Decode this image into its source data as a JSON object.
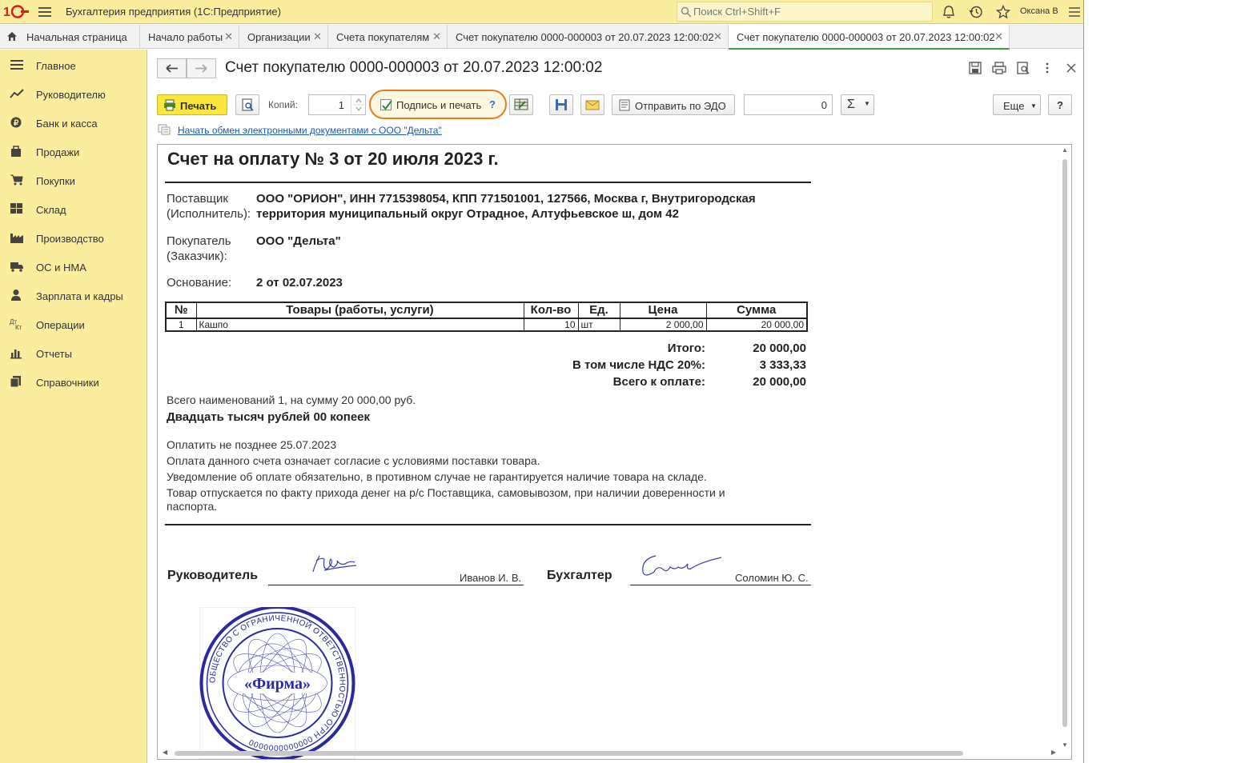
{
  "app": {
    "title": "Бухгалтерия предприятия  (1С:Предприятие)",
    "search_placeholder": "Поиск Ctrl+Shift+F",
    "user": "Оксана В"
  },
  "tabs": [
    {
      "label": "Начальная страница"
    },
    {
      "label": "Начало работы"
    },
    {
      "label": "Организации"
    },
    {
      "label": "Счета покупателям"
    },
    {
      "label": "Счет покупателю 0000-000003 от 20.07.2023 12:00:02"
    },
    {
      "label": "Счет покупателю 0000-000003 от 20.07.2023 12:00:02"
    }
  ],
  "sidebar": {
    "items": [
      {
        "label": "Главное",
        "icon": "menu-icon"
      },
      {
        "label": "Руководителю",
        "icon": "trend-icon"
      },
      {
        "label": "Банк и касса",
        "icon": "coin-icon"
      },
      {
        "label": "Продажи",
        "icon": "bag-icon"
      },
      {
        "label": "Покупки",
        "icon": "cart-icon"
      },
      {
        "label": "Склад",
        "icon": "warehouse-icon"
      },
      {
        "label": "Производство",
        "icon": "factory-icon"
      },
      {
        "label": "ОС и НМА",
        "icon": "truck-icon"
      },
      {
        "label": "Зарплата и кадры",
        "icon": "person-icon"
      },
      {
        "label": "Операции",
        "icon": "dt-kt-icon"
      },
      {
        "label": "Отчеты",
        "icon": "bar-chart-icon"
      },
      {
        "label": "Справочники",
        "icon": "books-icon"
      }
    ]
  },
  "form": {
    "title": "Счет покупателю 0000-000003 от 20.07.2023 12:00:02",
    "print_label": "Печать",
    "copies_label": "Копий:",
    "copies_value": "1",
    "sign_label": "Подпись и печать",
    "sign_help": "?",
    "sign_checked": true,
    "edo_label": "Отправить по ЭДО",
    "sum_value": "0",
    "sum_symbol": "Σ",
    "more_label": "Еще",
    "help_label": "?",
    "edo_link": "Начать обмен электронными документами с ООО \"Дельта\""
  },
  "invoice": {
    "heading": "Счет на оплату № 3 от 20 июля 2023 г.",
    "supplier_label_1": "Поставщик",
    "supplier_label_2": "(Исполнитель):",
    "supplier_line_1": "ООО \"ОРИОН\", ИНН 7715398054, КПП 771501001, 127566, Москва г, Внутригородская",
    "supplier_line_2": "территория муниципальный округ Отрадное, Алтуфьевское ш, дом 42",
    "buyer_label_1": "Покупатель",
    "buyer_label_2": "(Заказчик):",
    "buyer_value": "ООО \"Дельта\"",
    "basis_label": "Основание:",
    "basis_value": "2 от 02.07.2023",
    "table_headers": [
      "№",
      "Товары (работы, услуги)",
      "Кол-во",
      "Ед.",
      "Цена",
      "Сумма"
    ],
    "rows": [
      {
        "n": "1",
        "name": "Кашпо",
        "qty": "10",
        "unit": "шт",
        "price": "2 000,00",
        "sum": "20 000,00"
      }
    ],
    "total_label": "Итого:",
    "total_value": "20 000,00",
    "vat_label": "В том числе НДС 20%:",
    "vat_value": "3 333,33",
    "due_label": "Всего к оплате:",
    "due_value": "20 000,00",
    "count_line": "Всего наименований 1, на сумму 20 000,00 руб.",
    "amount_words": "Двадцать тысяч рублей 00 копеек",
    "note_1": "Оплатить не позднее 25.07.2023",
    "note_2": "Оплата данного счета означает согласие с условиями поставки товара.",
    "note_3": "Уведомление об оплате обязательно, в противном случае не гарантируется наличие товара на складе.",
    "note_4a": "Товар отпускается по факту прихода денег на р/с Поставщика, самовывозом, при наличии доверенности и",
    "note_4b": "паспорта.",
    "head_label": "Руководитель",
    "head_name": "Иванов И. В.",
    "accountant_label": "Бухгалтер",
    "accountant_name": "Соломин Ю. С.",
    "stamp_text": "«Фирма»",
    "stamp_ring": "ОБЩЕСТВО С ОГРАНИЧЕННОЙ ОТВЕТСТВЕННОСТЬЮ ОГРН 0000000000000"
  },
  "colors": {
    "accent": "#fbed9e",
    "print_button": "#fbe63b",
    "highlight": "#e87c1c",
    "link": "#1d57b6",
    "stamp": "#2a2a9a"
  }
}
